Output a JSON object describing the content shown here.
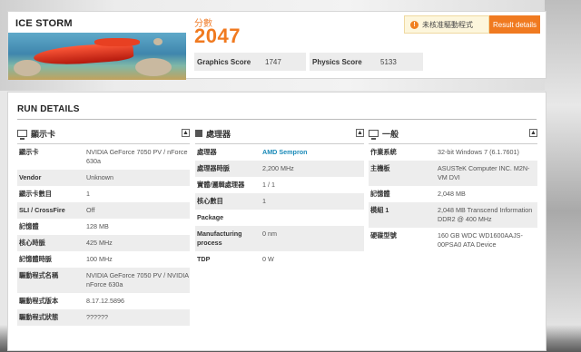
{
  "test": {
    "name": "ICE STORM",
    "score_label": "分數",
    "score": "2047",
    "notice": "未核准驅動程式",
    "result_button": "Result details",
    "graphics_score_label": "Graphics Score",
    "graphics_score": "1747",
    "physics_score_label": "Physics Score",
    "physics_score": "5133"
  },
  "details": {
    "title": "RUN DETAILS",
    "graphics": {
      "heading": "顯示卡",
      "rows": [
        {
          "k": "顯示卡",
          "v": "NVIDIA GeForce 7050 PV / nForce 630a"
        },
        {
          "k": "Vendor",
          "v": "Unknown"
        },
        {
          "k": "顯示卡數目",
          "v": "1"
        },
        {
          "k": "SLI / CrossFire",
          "v": "Off"
        },
        {
          "k": "記憶體",
          "v": "128 MB"
        },
        {
          "k": "核心時脈",
          "v": "425 MHz"
        },
        {
          "k": "記憶體時脈",
          "v": "100 MHz"
        },
        {
          "k": "驅動程式名稱",
          "v": "NVIDIA GeForce 7050 PV / NVIDIA nForce 630a"
        },
        {
          "k": "驅動程式版本",
          "v": "8.17.12.5896"
        },
        {
          "k": "驅動程式狀態",
          "v": "??????"
        }
      ]
    },
    "processor": {
      "heading": "處理器",
      "rows": [
        {
          "k": "處理器",
          "v": "AMD Sempron"
        },
        {
          "k": "處理器時脈",
          "v": "2,200 MHz"
        },
        {
          "k": "實體/邏輯處理器",
          "v": "1 / 1"
        },
        {
          "k": "核心數目",
          "v": "1"
        },
        {
          "k": "Package",
          "v": ""
        },
        {
          "k": "Manufacturing process",
          "v": "0 nm"
        },
        {
          "k": "TDP",
          "v": "0 W"
        }
      ]
    },
    "general": {
      "heading": "一般",
      "rows": [
        {
          "k": "作業系統",
          "v": "32-bit Windows 7 (6.1.7601)"
        },
        {
          "k": "主機板",
          "v": "ASUSTeK Computer INC. M2N-VM DVI"
        },
        {
          "k": "記憶體",
          "v": "2,048 MB"
        },
        {
          "k": "模組 1",
          "v": "2,048 MB Transcend Information DDR2 @ 400 MHz"
        },
        {
          "k": "硬碟型號",
          "v": "160 GB WDC WD1600AAJS-00PSA0 ATA Device"
        }
      ]
    },
    "collapse_glyph": "▲"
  },
  "colors": {
    "accent": "#f07a20",
    "link": "#1a8ab8"
  }
}
